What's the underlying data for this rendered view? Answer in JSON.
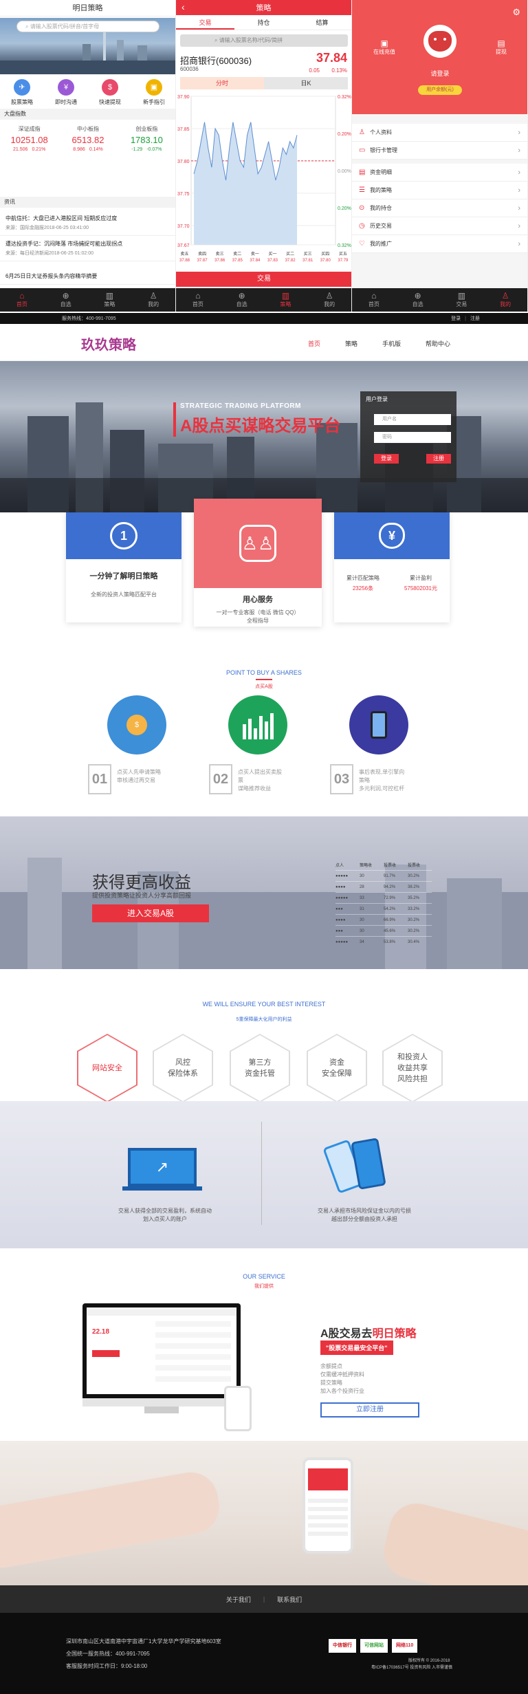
{
  "mobile_home": {
    "title": "明日策略",
    "search_placeholder": "请输入股票代码/拼音/首字母",
    "quick": [
      {
        "label": "股票策略",
        "color": "#4a8ee8",
        "icon": "airplane-icon",
        "glyph": "✈"
      },
      {
        "label": "即时沟通",
        "color": "#9b59d6",
        "icon": "yen-icon",
        "glyph": "¥"
      },
      {
        "label": "快速提现",
        "color": "#e84a6a",
        "icon": "withdraw-icon",
        "glyph": "$"
      },
      {
        "label": "新手指引",
        "color": "#f0b400",
        "icon": "guide-icon",
        "glyph": "▣"
      }
    ],
    "market_title": "大盘指数",
    "indexes": [
      {
        "name": "深证成指",
        "value": "10251.08",
        "change": "21.506",
        "pct": "0.21%",
        "color": "#e8333f"
      },
      {
        "name": "中小板指",
        "value": "6513.82",
        "change": "8.986",
        "pct": "0.14%",
        "color": "#e8333f"
      },
      {
        "name": "创业板指",
        "value": "1783.10",
        "change": "-1.29",
        "pct": "-0.07%",
        "color": "#1a9f3a"
      }
    ],
    "news_title": "资讯",
    "news": [
      {
        "title": "中航信托：大盘已进入港股区间 短期反应过度",
        "meta": "来源：国际金融报2018-06-25 03:41:00"
      },
      {
        "title": "遭达投资手记：沉闷降落 市场捕捉可能出现拐点",
        "meta": "来源：每日经济新闻2018-06-25 01:02:00"
      },
      {
        "title": "6月25日日大证券报头条内容精华摘要",
        "meta": ""
      }
    ],
    "tabs": [
      {
        "label": "首页",
        "icon": "home-icon",
        "glyph": "⌂",
        "active": true
      },
      {
        "label": "自选",
        "icon": "plus-circle-icon",
        "glyph": "⊕",
        "active": false
      },
      {
        "label": "策略",
        "icon": "bar-chart-icon",
        "glyph": "▥",
        "active": false
      },
      {
        "label": "我的",
        "icon": "person-icon",
        "glyph": "♙",
        "active": false
      }
    ]
  },
  "mobile_trade": {
    "title": "策略",
    "back": "‹",
    "tabs": [
      "交易",
      "持仓",
      "结算"
    ],
    "search_placeholder": "请输入股票名称/代码/简拼",
    "stock_name": "招商银行(600036)",
    "stock_code": "600036",
    "price": "37.84",
    "change": "0.05",
    "pct": "0.13%",
    "chart_tabs": [
      "分时",
      "日K"
    ],
    "trade_button": "交易",
    "tabbar": [
      {
        "label": "首页",
        "icon": "home-icon",
        "glyph": "⌂",
        "active": false
      },
      {
        "label": "自选",
        "icon": "plus-circle-icon",
        "glyph": "⊕",
        "active": false
      },
      {
        "label": "策略",
        "icon": "bar-chart-icon",
        "glyph": "▥",
        "active": true
      },
      {
        "label": "我的",
        "icon": "person-icon",
        "glyph": "♙",
        "active": false
      }
    ]
  },
  "chart_data": {
    "type": "line",
    "title": "",
    "xlabel": "",
    "ylabel": "",
    "ylim": [
      37.67,
      37.9
    ],
    "y_ticks_left": [
      "37.90",
      "37.85",
      "37.80",
      "37.75",
      "37.70",
      "37.67"
    ],
    "y_ticks_right": [
      "0.32%",
      "0.20%",
      "0.00%",
      "0.20%",
      "0.32%"
    ],
    "reference": 37.8,
    "series": [
      {
        "values": [
          37.78,
          37.8,
          37.83,
          37.86,
          37.82,
          37.79,
          37.85,
          37.84,
          37.8,
          37.77,
          37.82,
          37.86,
          37.83,
          37.8,
          37.79,
          37.84,
          37.86,
          37.82,
          37.78,
          37.79,
          37.81,
          37.83,
          37.8,
          37.77,
          37.79,
          37.82,
          37.81,
          37.83,
          37.82,
          37.84
        ]
      }
    ],
    "buy_sell": {
      "sell_prices": [
        "37.88",
        "37.87",
        "37.86",
        "37.85",
        "37.84"
      ],
      "buy_prices": [
        "37.83",
        "37.82",
        "37.81",
        "37.80",
        "37.79"
      ],
      "sell_labels": [
        "卖五",
        "卖四",
        "卖三",
        "卖二",
        "卖一"
      ],
      "buy_labels": [
        "买一",
        "买二",
        "买三",
        "买四",
        "买五"
      ]
    }
  },
  "mobile_user": {
    "username": "请登录",
    "login_badge": "用户余额(元)",
    "left_btn": "在线充值",
    "right_btn": "提现",
    "menu": [
      {
        "label": "个人资料",
        "icon": "user-icon",
        "glyph": "♙"
      },
      {
        "label": "银行卡管理",
        "icon": "card-icon",
        "glyph": "▭"
      },
      {
        "label": "资金明细",
        "icon": "trash-icon",
        "glyph": "▤"
      },
      {
        "label": "我的策略",
        "icon": "strategy-icon",
        "glyph": "☰"
      },
      {
        "label": "我的持仓",
        "icon": "holding-icon",
        "glyph": "⊙"
      },
      {
        "label": "历史交易",
        "icon": "history-icon",
        "glyph": "◷"
      },
      {
        "label": "我的推广",
        "icon": "promote-icon",
        "glyph": "♡"
      }
    ],
    "tabbar": [
      {
        "label": "首页",
        "icon": "home-icon",
        "glyph": "⌂",
        "active": false
      },
      {
        "label": "自选",
        "icon": "plus-circle-icon",
        "glyph": "⊕",
        "active": false
      },
      {
        "label": "交易",
        "icon": "bar-chart-icon",
        "glyph": "▥",
        "active": false
      },
      {
        "label": "我的",
        "icon": "person-icon",
        "glyph": "♙",
        "active": true
      }
    ]
  },
  "pc": {
    "topbar": {
      "hotline": "服务热线：400-991-7095",
      "login": "登录",
      "register": "注册"
    },
    "logo": "玖玖策略",
    "nav": [
      {
        "label": "首页",
        "active": true
      },
      {
        "label": "策略",
        "active": false
      },
      {
        "label": "手机版",
        "active": false
      },
      {
        "label": "帮助中心",
        "active": false
      }
    ],
    "banner": {
      "en": "STRATEGIC TRADING PLATFORM",
      "title": "A股点买谋略交易平台",
      "login_title": "用户登录",
      "user_placeholder": "用户名",
      "pass_placeholder": "密码",
      "login_btn": "登录",
      "register_btn": "注册"
    },
    "features": [
      {
        "title": "一分钟了解明日策略",
        "desc": "全新的投资人策略匹配平台",
        "icon": "clock-one-icon",
        "color": "#3d6fd0"
      },
      {
        "title": "用心服务",
        "desc": "一对一专业客服（电话 微信 QQ）\n全程指导",
        "icon": "users-icon",
        "color": "#ee6e73"
      },
      {
        "title": "",
        "desc": "",
        "icon": "money-bag-icon",
        "color": "#3d6fd0"
      }
    ],
    "stats": [
      {
        "label": "累计匹配策略",
        "value": "23256条"
      },
      {
        "label": "累计盈利",
        "value": "575802031元"
      }
    ],
    "point": {
      "en": "POINT TO BUY A SHARES",
      "cn": "点买A股"
    },
    "steps": [
      {
        "num": "01",
        "text": "点买人先申请策略\n审核通过再交易",
        "icon": "coins-hand-icon",
        "color": "#3d8fd8"
      },
      {
        "num": "02",
        "text": "点买人提出买卖股票\n谋略推荐收益",
        "icon": "bar-growth-icon",
        "color": "#1ea45a"
      },
      {
        "num": "03",
        "text": "事后表现,单引擎向策略\n多元利润,可控杠杆",
        "icon": "phone-hand-icon",
        "color": "#3a3aa0"
      }
    ],
    "income": {
      "title": "获得更高收益",
      "sub": "提供投资策略让投资人分享高额回报",
      "button": "进入交易A股",
      "table_head": [
        "点人",
        "策略收",
        "投票收",
        "投票收"
      ],
      "table_rows": [
        [
          "●●●●●",
          "30",
          "91.7%",
          "30.2%"
        ],
        [
          "●●●●",
          "28",
          "94.2%",
          "38.2%"
        ],
        [
          "●●●●●",
          "33",
          "72.9%",
          "35.2%"
        ],
        [
          "●●●",
          "31",
          "54.2%",
          "33.2%"
        ],
        [
          "●●●●",
          "30",
          "66.9%",
          "30.2%"
        ],
        [
          "●●●",
          "30",
          "45.6%",
          "30.2%"
        ],
        [
          "●●●●●",
          "34",
          "53.8%",
          "30.4%"
        ]
      ]
    },
    "ensure": {
      "en": "WE WILL ENSURE YOUR BEST INTEREST",
      "cn": "5重保障最大化用户的利益"
    },
    "hexes": [
      "网站安全",
      "风控\n保险体系",
      "第三方\n资金托管",
      "资金\n安全保障",
      "和投资人\n收益共享\n风险共担"
    ],
    "split": [
      {
        "text": "交易人获得全部的交易盈利，系统自动\n划入点买人的账户",
        "icon": "laptop-chart-icon"
      },
      {
        "text": "交易人承担市场风险保证金以内的亏损\n越出部分全额由投资人承担",
        "icon": "phones-icon"
      }
    ],
    "service": {
      "en": "OUR SERVICE",
      "cn": "我们提供",
      "title_a": "A股交易去",
      "title_b": "明日策略",
      "badge": "\"股票交易最安全平台\"",
      "items": [
        "余额提点",
        "仅需缓冲抵押资料",
        "提交策略",
        "加入各个投资行业"
      ],
      "btn": "立即注册",
      "screen_price": "22.18"
    },
    "footer": {
      "links": [
        "关于我们",
        "联系我们"
      ],
      "address": "深圳市南山区大道南港中宇宙通厂1大学龙华产学研究基地603室",
      "hotline": "全国统一服务热线：400-991-7095",
      "hours": "客服服务时间工作日：9:00-18:00",
      "copyright": "版权所有 © 2016-2018",
      "icp": "粤ICP备17036517号 投资有风险 入市需谨慎",
      "badges": [
        {
          "label": "中信银行",
          "color": "#c8161d"
        },
        {
          "label": "可信网站",
          "color": "#3aa23a"
        },
        {
          "label": "网络110",
          "color": "#d21d2b"
        }
      ]
    }
  },
  "colors": {
    "red": "#e8333f",
    "blue": "#3d6fd0",
    "purple": "#a8388f",
    "dark": "#1e1e1e"
  }
}
